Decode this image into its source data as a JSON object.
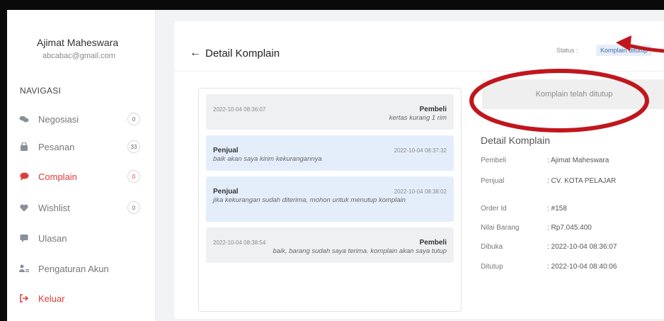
{
  "sidebar": {
    "user": {
      "name": "Ajimat Maheswara",
      "email": "abcabac@gmail.com"
    },
    "nav_heading": "NAVIGASI",
    "items": [
      {
        "label": "Negosiasi",
        "badge": "0",
        "icon": "handshake-icon",
        "active": false
      },
      {
        "label": "Pesanan",
        "badge": "33",
        "icon": "bag-icon",
        "active": false
      },
      {
        "label": "Complain",
        "badge": "0",
        "icon": "chat-icon",
        "active": true
      },
      {
        "label": "Wishlist",
        "badge": "0",
        "icon": "heart-icon",
        "active": false
      },
      {
        "label": "Ulasan",
        "icon": "comment-icon",
        "active": false
      },
      {
        "label": "Pengaturan Akun",
        "icon": "user-settings-icon",
        "active": false
      },
      {
        "label": "Keluar",
        "icon": "logout-icon",
        "active": true
      }
    ]
  },
  "header": {
    "back_arrow": "←",
    "title": "Detail Komplain",
    "status_label": "Status :",
    "status_value": "Komplain ditutup"
  },
  "chat": {
    "messages": [
      {
        "role": "Pembeli",
        "timestamp": "2022-10-04 08:36:07",
        "text": "kertas kurang 1 rim"
      },
      {
        "role": "Penjual",
        "timestamp": "2022-10-04 08:37:32",
        "text": "baik akan saya kirim kekurangannya"
      },
      {
        "role": "Penjual",
        "timestamp": "2022-10-04 08:38:02",
        "text": "jika kekurangan sudah diterima, mohon untuk menutup komplain"
      },
      {
        "role": "Pembeli",
        "timestamp": "2022-10-04 08:38:54",
        "text": "baik, barang sudah saya terima. komplain akan saya tutup"
      }
    ]
  },
  "closed_notice": "Komplain telah ditutup",
  "detail": {
    "title": "Detail Komplain",
    "fields": [
      {
        "label": "Pembeli",
        "value": ": Ajimat Maheswara"
      },
      {
        "label": "Penjual",
        "value": ": CV. KOTA PELAJAR"
      },
      {
        "label": "Order Id",
        "value": ": #158"
      },
      {
        "label": "Nilai Barang",
        "value": ": Rp7.045.400"
      },
      {
        "label": "Dibuka",
        "value": ": 2022-10-04 08:36:07"
      },
      {
        "label": "Ditutup",
        "value": ": 2022-10-04 08:40:06"
      }
    ]
  },
  "colors": {
    "accent_red": "#e03b3b",
    "annotation_red": "#c0161c",
    "seller_bubble": "#e4eefb",
    "buyer_bubble": "#eef0f2"
  }
}
